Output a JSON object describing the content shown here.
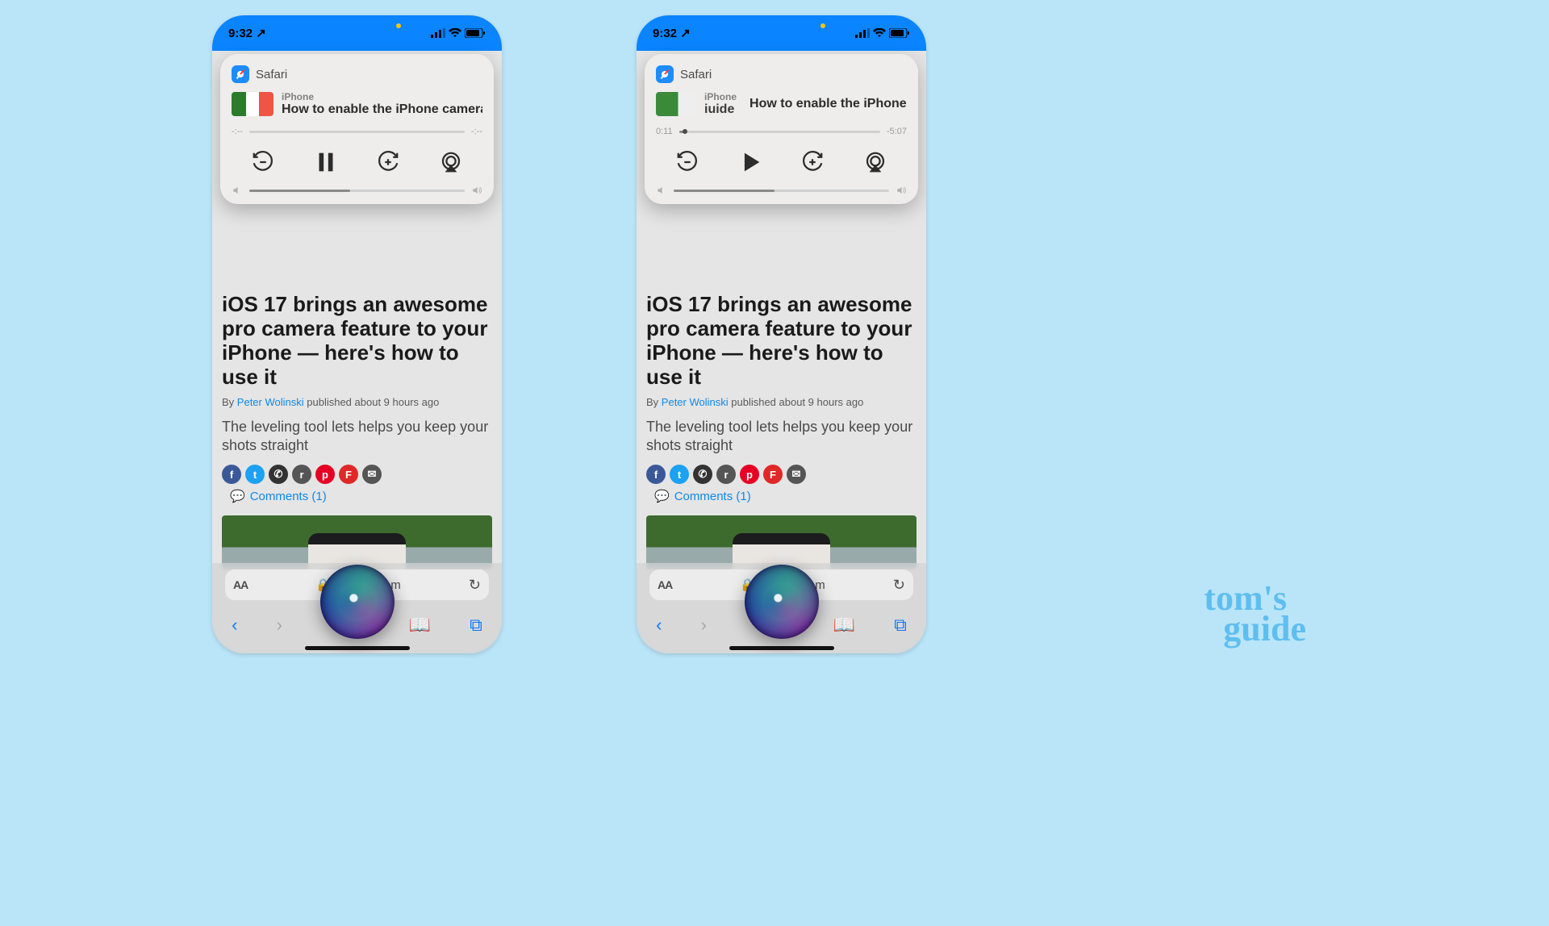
{
  "status": {
    "time": "9:32",
    "loc_arrow": "↗"
  },
  "media": {
    "app": "Safari",
    "site": "iPhone",
    "brand_fragment": "iuide",
    "title_left": "How to enable the iPhone camera le",
    "title_right": "How to enable the iPhone c",
    "scrub_left": {
      "cur": "-:--",
      "rem": "-:--",
      "pct": 0
    },
    "scrub_right": {
      "cur": "0:11",
      "rem": "-5:07",
      "pct": 3
    },
    "vol_left_pct": 47,
    "vol_right_pct": 47
  },
  "article": {
    "headline": "iOS 17 brings an awesome pro camera feature to your iPhone — here's how to use it",
    "by_prefix": "By ",
    "author": "Peter Wolinski",
    "pub": " published about 9 hours ago",
    "lede": "The leveling tool lets helps you keep your shots straight",
    "comments": "Comments (1)"
  },
  "share": {
    "fb": "f",
    "tw": "t",
    "wa": "✆",
    "rd": "r",
    "pn": "p",
    "fl": "F",
    "em": "✉"
  },
  "url": {
    "aa": "AA",
    "lock": "🔒",
    "host_l": "to",
    "host_r": "com",
    "reload": "↻"
  },
  "toolbar": {
    "back": "‹",
    "fwd": "›",
    "book": "📖",
    "tabs": "⧉"
  },
  "watermark": {
    "l1": "tom's",
    "l2": "guide"
  }
}
